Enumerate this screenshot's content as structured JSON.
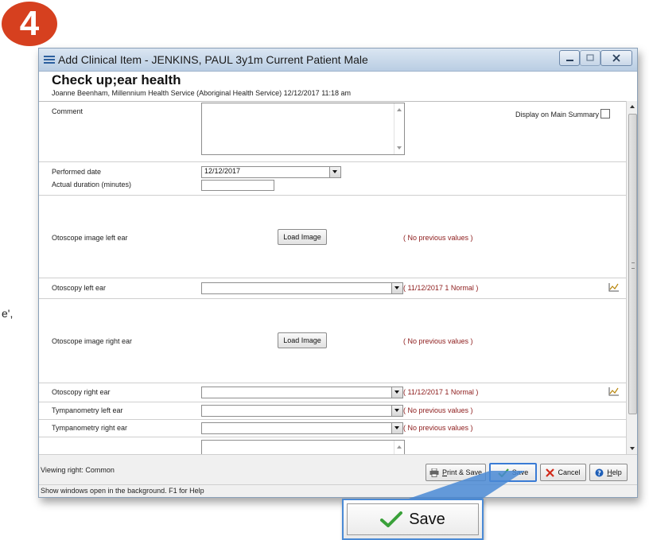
{
  "step_number": "4",
  "page_fragment_text": "e',",
  "window": {
    "title": "Add Clinical Item - JENKINS, PAUL 3y1m Current Patient Male"
  },
  "header": {
    "item_title": "Check up;ear health",
    "item_subtitle": "Joanne Beenham, Millennium Health Service (Aboriginal Health Service) 12/12/2017 11:18 am"
  },
  "form": {
    "comment_label": "Comment",
    "display_on_main_summary_label": "Display on Main Summary",
    "display_on_main_summary_checked": false,
    "performed_date_label": "Performed date",
    "performed_date_value": "12/12/2017",
    "actual_duration_label": "Actual duration (minutes)",
    "otoscope_left_label": "Otoscope image left ear",
    "otoscope_left_button": "Load Image",
    "otoscope_left_prev": "( No previous values )",
    "otoscopy_left_label": "Otoscopy left ear",
    "otoscopy_left_prev": "( 11/12/2017  1 Normal )",
    "otoscope_right_label": "Otoscope image right ear",
    "otoscope_right_button": "Load Image",
    "otoscope_right_prev": "( No previous values )",
    "otoscopy_right_label": "Otoscopy right ear",
    "otoscopy_right_prev": "( 11/12/2017  1 Normal )",
    "tymp_left_label": "Tympanometry left ear",
    "tymp_left_prev": "( No previous values )",
    "tymp_right_label": "Tympanometry right ear",
    "tymp_right_prev": "( No previous values )"
  },
  "footer": {
    "viewing_right": "Viewing right: Common",
    "print_save_prefix": "",
    "print_save_underlined": "P",
    "print_save_rest": "rint & Save",
    "save": "Save",
    "cancel": "Cancel",
    "help_underlined": "H",
    "help_rest": "elp"
  },
  "status_bar": "Show windows open in the background. F1 for Help",
  "zoom_callout": {
    "label": "Save"
  },
  "colors": {
    "badge": "#d6401f",
    "previous_values_text": "#8c1a1a",
    "callout_border": "#4a8ad5",
    "checkmark_green": "#3aa13a",
    "cancel_red": "#d12a1a"
  }
}
